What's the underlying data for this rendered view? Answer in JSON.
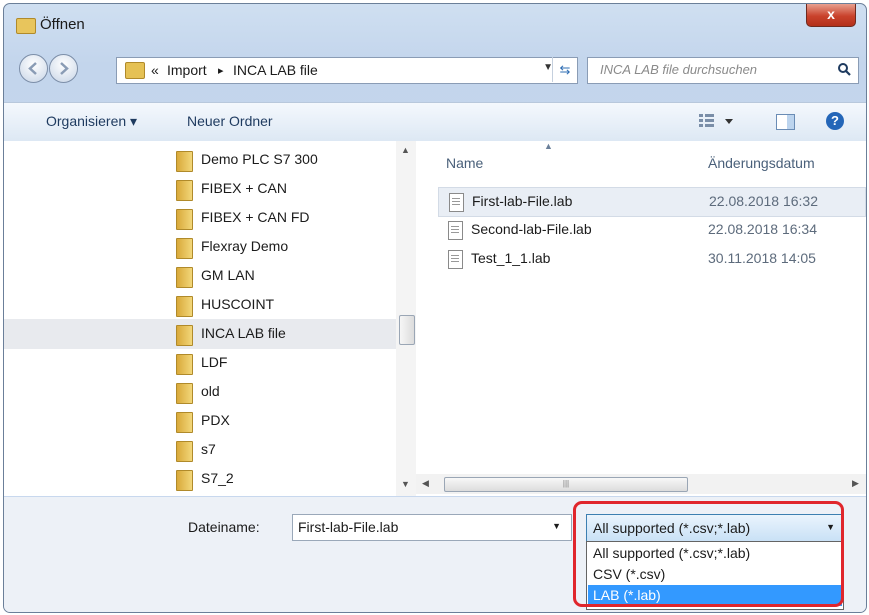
{
  "window": {
    "title": "Öffnen",
    "close_symbol": "x"
  },
  "address": {
    "overflow": "«",
    "segments": [
      "Import",
      "INCA LAB file"
    ],
    "separator": "▸",
    "search_placeholder": "INCA LAB file durchsuchen"
  },
  "toolbar": {
    "organize": "Organisieren ▾",
    "new_folder": "Neuer Ordner",
    "help": "?"
  },
  "tree": {
    "items": [
      "Demo PLC S7 300",
      "FIBEX + CAN",
      "FIBEX + CAN FD",
      "Flexray Demo",
      "GM LAN",
      "HUSCOINT",
      "INCA LAB file",
      "LDF",
      "old",
      "PDX",
      "s7",
      "S7_2"
    ],
    "selected": "INCA LAB file"
  },
  "files": {
    "columns": {
      "name": "Name",
      "date": "Änderungsdatum"
    },
    "rows": [
      {
        "name": "First-lab-File.lab",
        "date": "22.08.2018 16:32"
      },
      {
        "name": "Second-lab-File.lab",
        "date": "22.08.2018 16:34"
      },
      {
        "name": "Test_1_1.lab",
        "date": "30.11.2018 14:05"
      }
    ],
    "selected": "First-lab-File.lab"
  },
  "bottom": {
    "filename_label": "Dateiname:",
    "filename_value": "First-lab-File.lab",
    "filetype_selected": "All supported (*.csv;*.lab)",
    "filetype_options": [
      "All supported (*.csv;*.lab)",
      "CSV (*.csv)",
      "LAB (*.lab)"
    ],
    "highlighted_option": "LAB (*.lab)"
  },
  "colors": {
    "highlight": "#3399ff",
    "outline": "#e0262c",
    "close": "#c9422c"
  }
}
